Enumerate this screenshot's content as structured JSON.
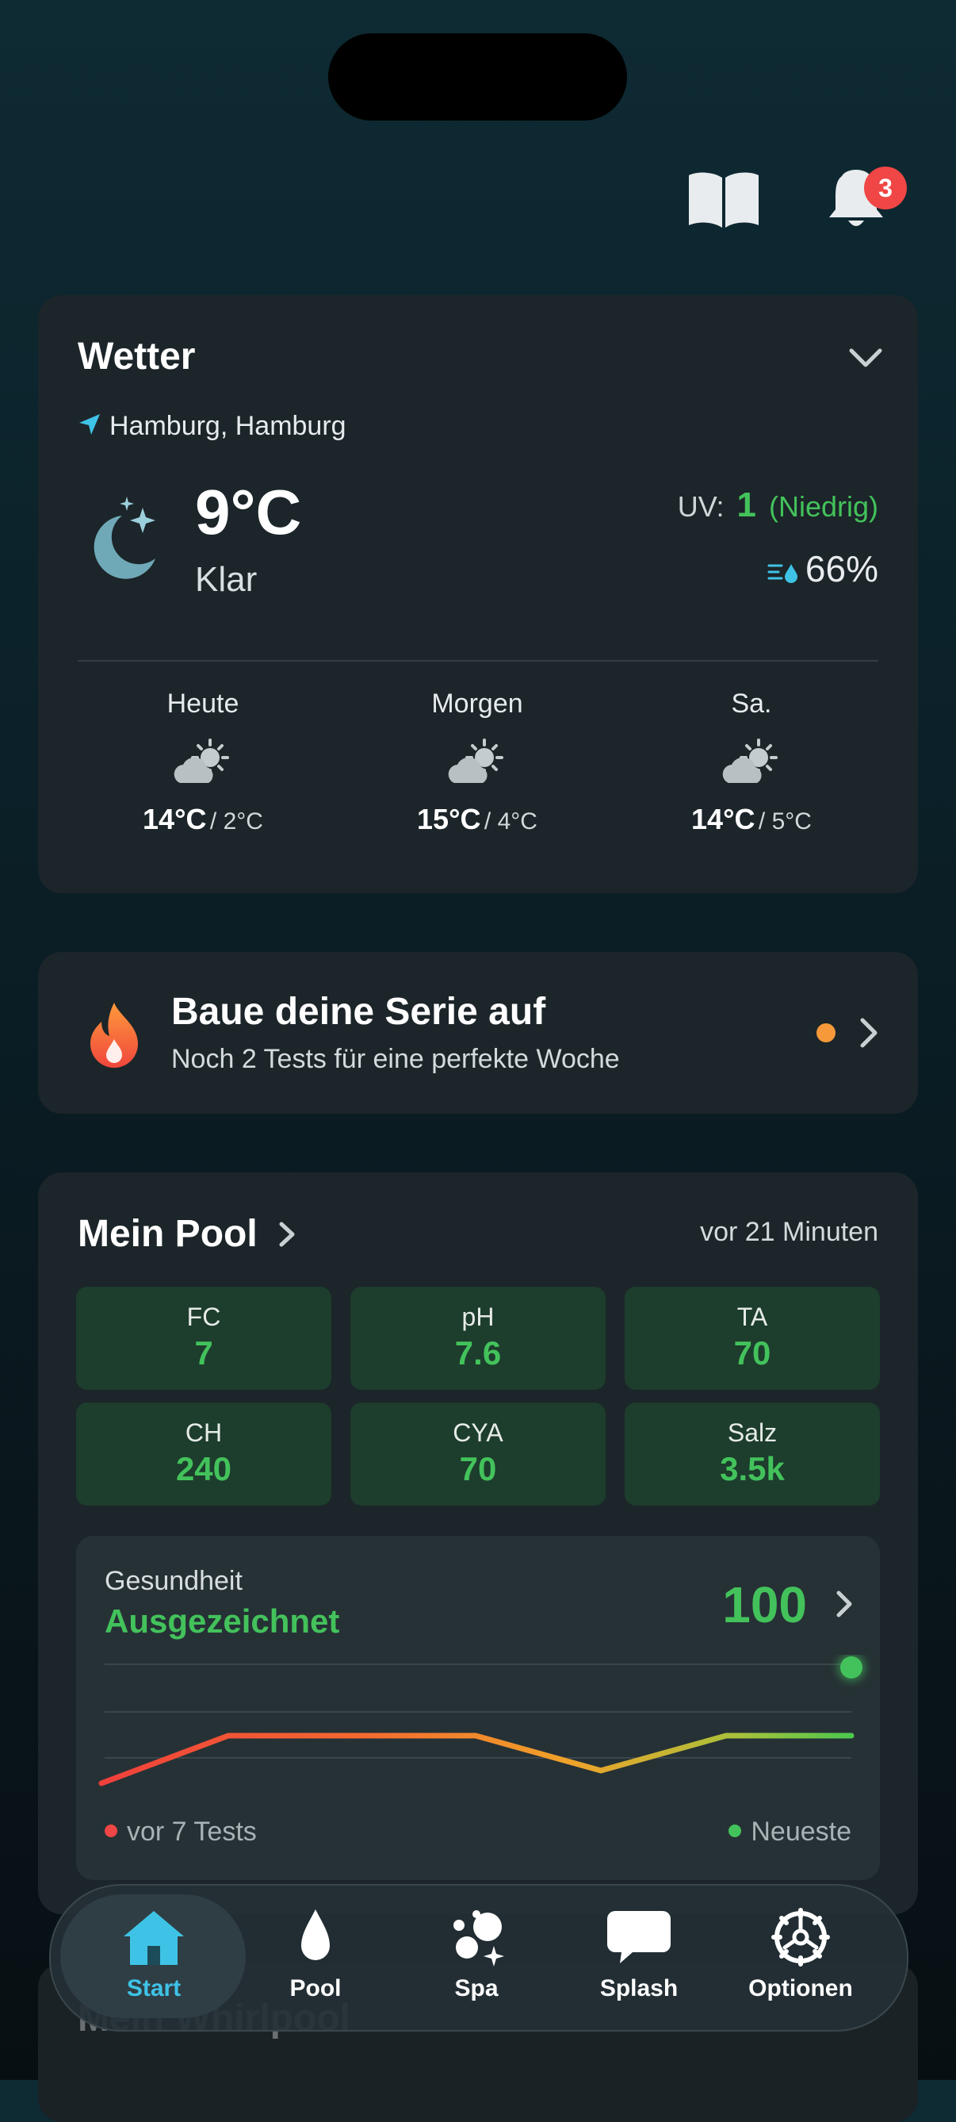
{
  "header": {
    "book_icon": "book-open-icon",
    "bell_icon": "bell-icon",
    "notification_count": "3"
  },
  "weather": {
    "title": "Wetter",
    "location": "Hamburg, Hamburg",
    "temperature": "9°C",
    "condition": "Klar",
    "uv_label": "UV:",
    "uv_value": "1",
    "uv_text": "(Niedrig)",
    "humidity": "66%",
    "forecast": [
      {
        "day": "Heute",
        "high": "14°C",
        "low": "/ 2°C"
      },
      {
        "day": "Morgen",
        "high": "15°C",
        "low": "/ 4°C"
      },
      {
        "day": "Sa.",
        "high": "14°C",
        "low": "/ 5°C"
      }
    ]
  },
  "streak": {
    "title": "Baue deine Serie auf",
    "subtitle": "Noch 2 Tests für eine perfekte Woche"
  },
  "pool": {
    "title": "Mein Pool",
    "updated": "vor 21 Minuten",
    "metrics": [
      {
        "label": "FC",
        "value": "7"
      },
      {
        "label": "pH",
        "value": "7.6"
      },
      {
        "label": "TA",
        "value": "70"
      },
      {
        "label": "CH",
        "value": "240"
      },
      {
        "label": "CYA",
        "value": "70"
      },
      {
        "label": "Salz",
        "value": "3.5k"
      }
    ],
    "health": {
      "label": "Gesundheit",
      "status": "Ausgezeichnet",
      "score": "100",
      "legend_old": "vor 7 Tests",
      "legend_new": "Neueste"
    }
  },
  "next_card_title": "Mein Whirlpool",
  "nav": {
    "items": [
      {
        "label": "Start",
        "icon": "home-icon"
      },
      {
        "label": "Pool",
        "icon": "drop-icon"
      },
      {
        "label": "Spa",
        "icon": "bubbles-icon"
      },
      {
        "label": "Splash",
        "icon": "chat-bubble-icon"
      },
      {
        "label": "Optionen",
        "icon": "gear-icon"
      }
    ]
  },
  "colors": {
    "accent_green": "#43c25b",
    "accent_blue": "#3ec3e6",
    "badge_red": "#f04646",
    "card_bg": "#1c2529"
  }
}
